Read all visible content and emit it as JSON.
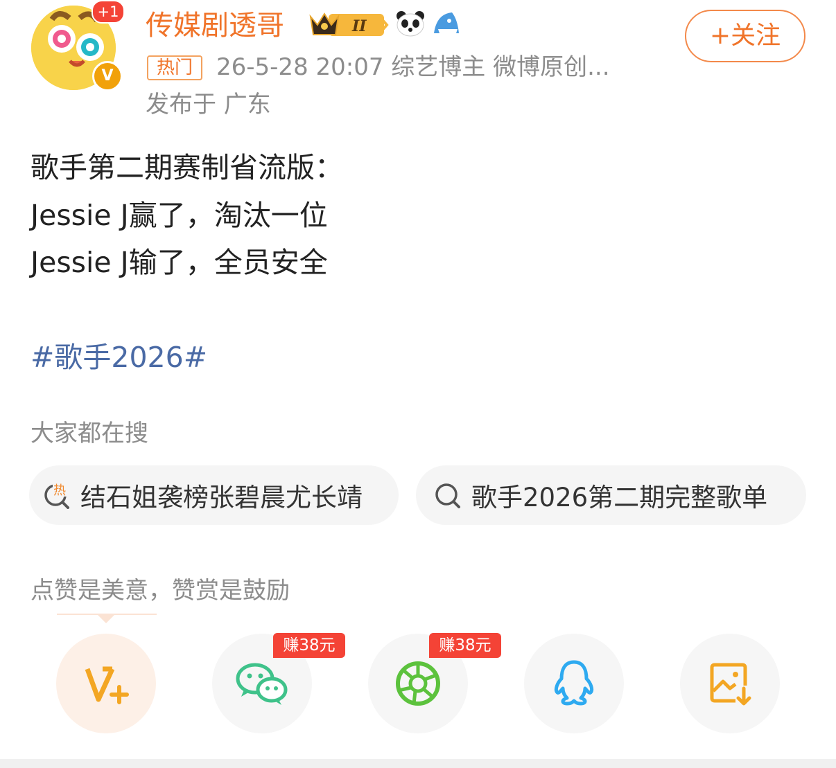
{
  "author": {
    "name": "传媒剧透哥",
    "avatar_badge": "+1",
    "verified_mark": "V",
    "level_badge": "II"
  },
  "header": {
    "follow_label": "+关注",
    "hot_tag": "热门",
    "meta": "26-5-28 20:07  综艺博主 微博原创...",
    "location": "发布于 广东"
  },
  "post": {
    "lines": [
      "歌手第二期赛制省流版：",
      "Jessie J赢了，淘汰一位",
      "Jessie J输了，全员安全"
    ],
    "hashtag": "#歌手2026#"
  },
  "search": {
    "label": "大家都在搜",
    "hot_icon_text": "热",
    "chips": [
      "结石姐袭榜张碧晨尤长靖",
      "歌手2026第二期完整歌单"
    ]
  },
  "reward": {
    "label": "点赞是美意，赞赏是鼓励"
  },
  "share": {
    "items": [
      {
        "name": "reward",
        "icon": "v-plus-icon"
      },
      {
        "name": "wechat",
        "icon": "wechat-icon",
        "earn": "赚38元"
      },
      {
        "name": "moments",
        "icon": "moments-icon",
        "earn": "赚38元"
      },
      {
        "name": "qq",
        "icon": "qq-icon"
      },
      {
        "name": "save-image",
        "icon": "save-image-icon"
      }
    ]
  },
  "colors": {
    "accent": "#f0742a",
    "hashtag": "#4a6aa5",
    "earn": "#f44336",
    "wechat": "#3fc28a",
    "moments": "#5cc23d",
    "qq": "#2eaaf0",
    "save": "#f3a623"
  }
}
